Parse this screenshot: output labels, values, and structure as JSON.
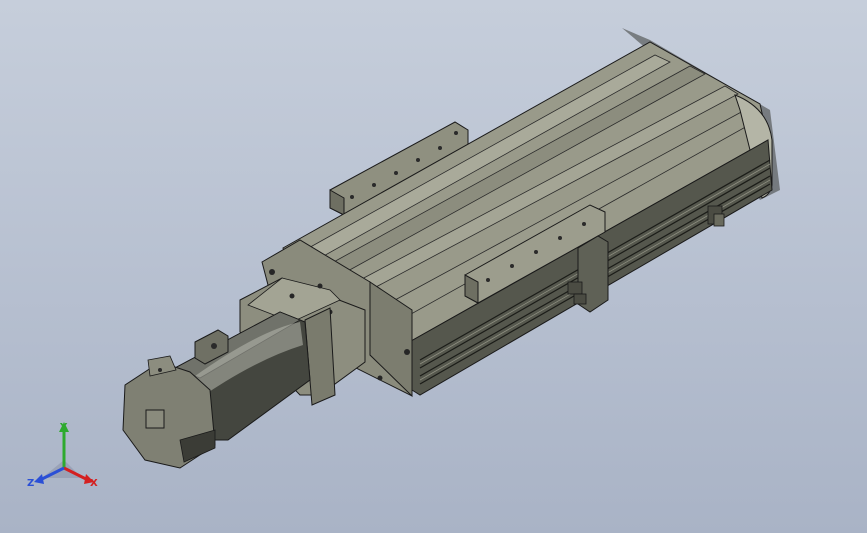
{
  "scene": {
    "model_name": "",
    "background_top": "#c6cedb",
    "background_bottom": "#a9b3c6",
    "body_color": "#8e8f80",
    "body_dark": "#5a5c52",
    "edge_color": "#1a1a1a"
  },
  "triad": {
    "x_label": "X",
    "y_label": "Y",
    "z_label": "Z",
    "x_color": "#d42020",
    "y_color": "#2eaa2e",
    "z_color": "#2a4fd6"
  }
}
